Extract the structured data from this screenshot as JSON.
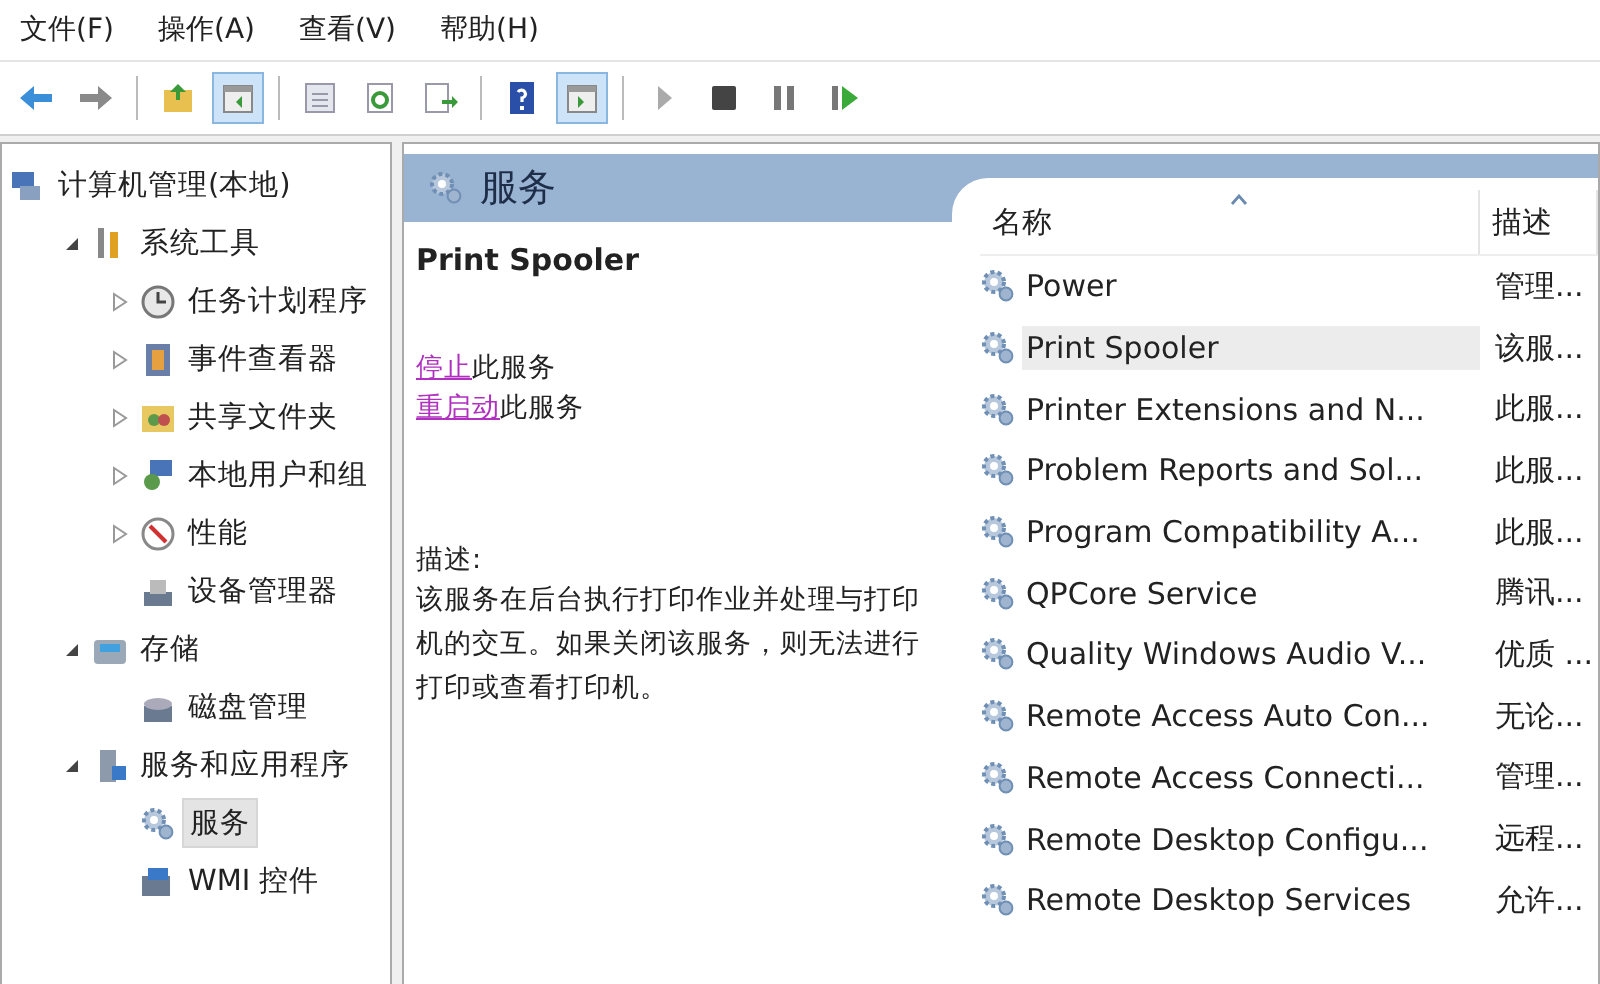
{
  "menu": [
    "文件(F)",
    "操作(A)",
    "查看(V)",
    "帮助(H)"
  ],
  "toolbar": [
    [
      {
        "on": false
      },
      {
        "on": false
      }
    ],
    [
      {
        "on": false
      },
      {
        "on": true
      }
    ],
    [
      {
        "on": false
      },
      {
        "on": false
      },
      {
        "on": false
      }
    ],
    [
      {
        "on": false
      },
      {
        "on": true
      }
    ],
    [
      {
        "on": false
      },
      {
        "on": false
      },
      {
        "on": false
      },
      {
        "on": false
      }
    ]
  ],
  "tree": [
    {
      "label": "计算机管理(本地)",
      "kind": "root",
      "selected": false,
      "children": [
        {
          "label": "系统工具",
          "kind": "branch",
          "expanded": true,
          "selected": false,
          "children": [
            {
              "label": "任务计划程序",
              "kind": "branch",
              "expanded": false,
              "selected": false
            },
            {
              "label": "事件查看器",
              "kind": "branch",
              "expanded": false,
              "selected": false
            },
            {
              "label": "共享文件夹",
              "kind": "branch",
              "expanded": false,
              "selected": false
            },
            {
              "label": "本地用户和组",
              "kind": "branch",
              "expanded": false,
              "selected": false
            },
            {
              "label": "性能",
              "kind": "branch",
              "expanded": false,
              "selected": false
            },
            {
              "label": "设备管理器",
              "kind": "leaf",
              "selected": false
            }
          ]
        },
        {
          "label": "存储",
          "kind": "branch",
          "expanded": true,
          "selected": false,
          "children": [
            {
              "label": "磁盘管理",
              "kind": "leaf",
              "selected": false
            }
          ]
        },
        {
          "label": "服务和应用程序",
          "kind": "branch",
          "expanded": true,
          "selected": false,
          "children": [
            {
              "label": "服务",
              "kind": "leaf",
              "selected": true
            },
            {
              "label": "WMI 控件",
              "kind": "leaf",
              "selected": false
            }
          ]
        }
      ]
    }
  ],
  "header": {
    "title": "服务"
  },
  "details": {
    "title": "Print Spooler",
    "actions": [
      {
        "link": "停止",
        "text": "此服务"
      },
      {
        "link": "重启动",
        "text": "此服务"
      }
    ],
    "description_label": "描述:",
    "description": "该服务在后台执行打印作业并处理与打印机的交互。如果关闭该服务，则无法进行打印或查看打印机。"
  },
  "table": {
    "columns": [
      {
        "label": "名称",
        "sorted": true
      },
      {
        "label": "描述",
        "sorted": false
      }
    ],
    "rows": [
      {
        "name": "Power",
        "description": "管理...",
        "selected": false
      },
      {
        "name": "Print Spooler",
        "description": "该服...",
        "selected": true
      },
      {
        "name": "Printer Extensions and N...",
        "description": "此服...",
        "selected": false
      },
      {
        "name": "Problem Reports and Sol...",
        "description": "此服...",
        "selected": false
      },
      {
        "name": "Program Compatibility A...",
        "description": "此服...",
        "selected": false
      },
      {
        "name": "QPCore Service",
        "description": "腾讯...",
        "selected": false
      },
      {
        "name": "Quality Windows Audio V...",
        "description": "优质 ...",
        "selected": false
      },
      {
        "name": "Remote Access Auto Con...",
        "description": "无论...",
        "selected": false
      },
      {
        "name": "Remote Access Connecti...",
        "description": "管理...",
        "selected": false
      },
      {
        "name": "Remote Desktop Configu...",
        "description": "远程...",
        "selected": false
      },
      {
        "name": "Remote Desktop Services",
        "description": "允许...",
        "selected": false
      }
    ]
  }
}
